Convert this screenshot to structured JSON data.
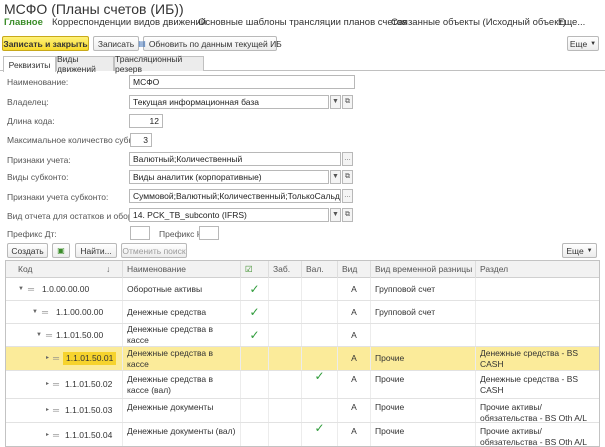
{
  "window": {
    "title": "МСФО (Планы счетов (ИБ))"
  },
  "nav": {
    "main": "Главное",
    "items": [
      "Корреспонденции видов движений",
      "Основные шаблоны трансляции планов счетов",
      "Связанные объекты (Исходный объект)",
      "Еще..."
    ]
  },
  "toolbar": {
    "save_close": "Записать и закрыть",
    "save": "Записать",
    "update": "Обновить по данным текущей ИБ",
    "more": "Еще"
  },
  "tabs": [
    "Реквизиты",
    "Виды движений",
    "Трансляционный резерв"
  ],
  "form": {
    "name_label": "Наименование:",
    "name_value": "МСФО",
    "owner_label": "Владелец:",
    "owner_value": "Текущая информационная база",
    "code_len_label": "Длина кода:",
    "code_len_value": "12",
    "max_subconto_label": "Максимальное количество субконто:",
    "max_subconto_value": "3",
    "acc_attrs_label": "Признаки учета:",
    "acc_attrs_value": "Валютный;Количественный",
    "subconto_types_label": "Виды субконто:",
    "subconto_types_value": "Виды аналитик (корпоративные)",
    "subconto_attrs_label": "Признаки учета субконто:",
    "subconto_attrs_value": "Суммовой;Валютный;Количественный;ТолькоСальдо",
    "report_type_label": "Вид отчета для остатков и оборотов:",
    "report_type_value": "14. PCK_TB_subconto (IFRS)",
    "prefix_dt_label": "Префикс Дт:",
    "prefix_dt_value": "",
    "prefix_kt_label": "Префикс Кт:",
    "prefix_kt_value": ""
  },
  "grid_toolbar": {
    "create": "Создать",
    "find": "Найти...",
    "cancel_search": "Отменить поиск",
    "more": "Еще"
  },
  "grid": {
    "headers": {
      "code": "Код",
      "sort": "↓",
      "name": "Наименование",
      "zab": "Заб.",
      "val": "Вал.",
      "type": "Вид",
      "temp": "Вид временной разницы",
      "section": "Раздел"
    },
    "rows": [
      {
        "code": "1.0.00.00.00",
        "name": "Оборотные активы",
        "flag": true,
        "zab": false,
        "val": false,
        "type": "А",
        "temp": "Групповой счет",
        "section": ""
      },
      {
        "code": "1.1.00.00.00",
        "name": "Денежные средства",
        "flag": true,
        "zab": false,
        "val": false,
        "type": "А",
        "temp": "Групповой счет",
        "section": ""
      },
      {
        "code": "1.1.01.50.00",
        "name": "Денежные средства в кассе",
        "flag": true,
        "zab": false,
        "val": false,
        "type": "А",
        "temp": "",
        "section": ""
      },
      {
        "code": "1.1.01.50.01",
        "name": "Денежные средства в кассе",
        "flag": false,
        "zab": false,
        "val": false,
        "type": "А",
        "temp": "Прочие",
        "section": "Денежные средства - BS CASH"
      },
      {
        "code": "1.1.01.50.02",
        "name": "Денежные средства в кассе (вал)",
        "flag": false,
        "zab": false,
        "val": true,
        "type": "А",
        "temp": "Прочие",
        "section": "Денежные средства - BS CASH"
      },
      {
        "code": "1.1.01.50.03",
        "name": "Денежные документы",
        "flag": false,
        "zab": false,
        "val": false,
        "type": "А",
        "temp": "Прочие",
        "section": "Прочие активы/обязательства - BS Oth A/L"
      },
      {
        "code": "1.1.01.50.04",
        "name": "Денежные документы (вал)",
        "flag": false,
        "zab": false,
        "val": true,
        "type": "А",
        "temp": "Прочие",
        "section": "Прочие активы/обязательства - BS Oth A/L"
      }
    ]
  },
  "colors": {
    "accent": "#3b8d2a",
    "primary_button": "#f6d92b",
    "selected_row": "#fbeb9a",
    "check": "#2e9b3a"
  },
  "icons": {
    "calendar": "calendar-icon",
    "open": "open-icon",
    "dropdown": "chevron-down-icon",
    "check": "check-icon"
  }
}
